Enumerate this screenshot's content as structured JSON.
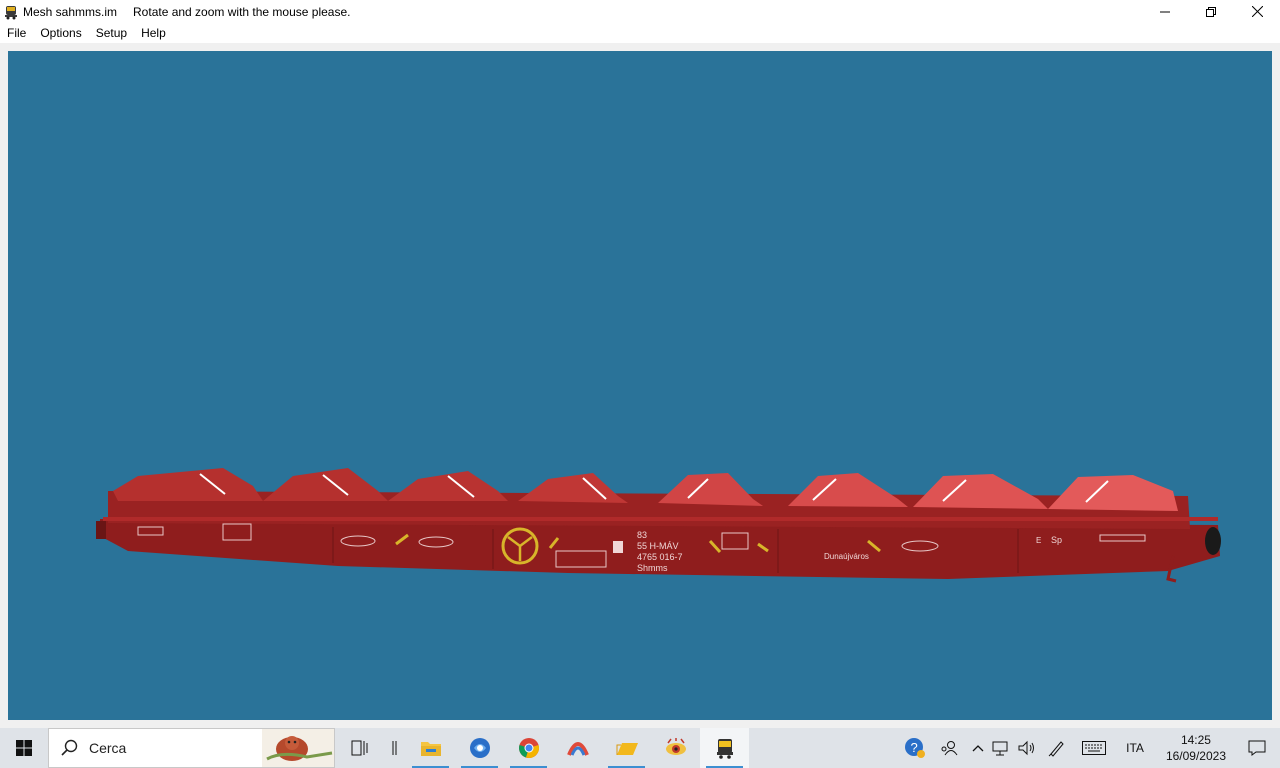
{
  "window": {
    "title": "Mesh sahmms.im",
    "hint": "Rotate and zoom with the mouse please."
  },
  "menu": {
    "items": [
      "File",
      "Options",
      "Setup",
      "Help"
    ]
  },
  "canvas": {
    "background": "#2a7399",
    "wagon": {
      "body_color": "#8f1d1d",
      "cover_color": "#b5302e",
      "cover_highlight": "#e35a5a",
      "marking_color": "#f0d7d7",
      "accent_yellow": "#d8b52a",
      "markings": {
        "line1": "83",
        "line2": "55 H-MÁV",
        "line3": "4765 016-7",
        "line4": "Shmms",
        "station": "Dunaújváros",
        "sp": "Sp",
        "e": "E"
      }
    }
  },
  "taskbar": {
    "search_placeholder": "Cerca",
    "icons": [
      "task-view-icon",
      "file-explorer-icon",
      "browser-icon",
      "chrome-icon",
      "app-icon",
      "folder-icon",
      "viewer-icon",
      "mesh-app-icon"
    ],
    "tray": {
      "language": "ITA",
      "time": "14:25",
      "date": "16/09/2023"
    }
  }
}
